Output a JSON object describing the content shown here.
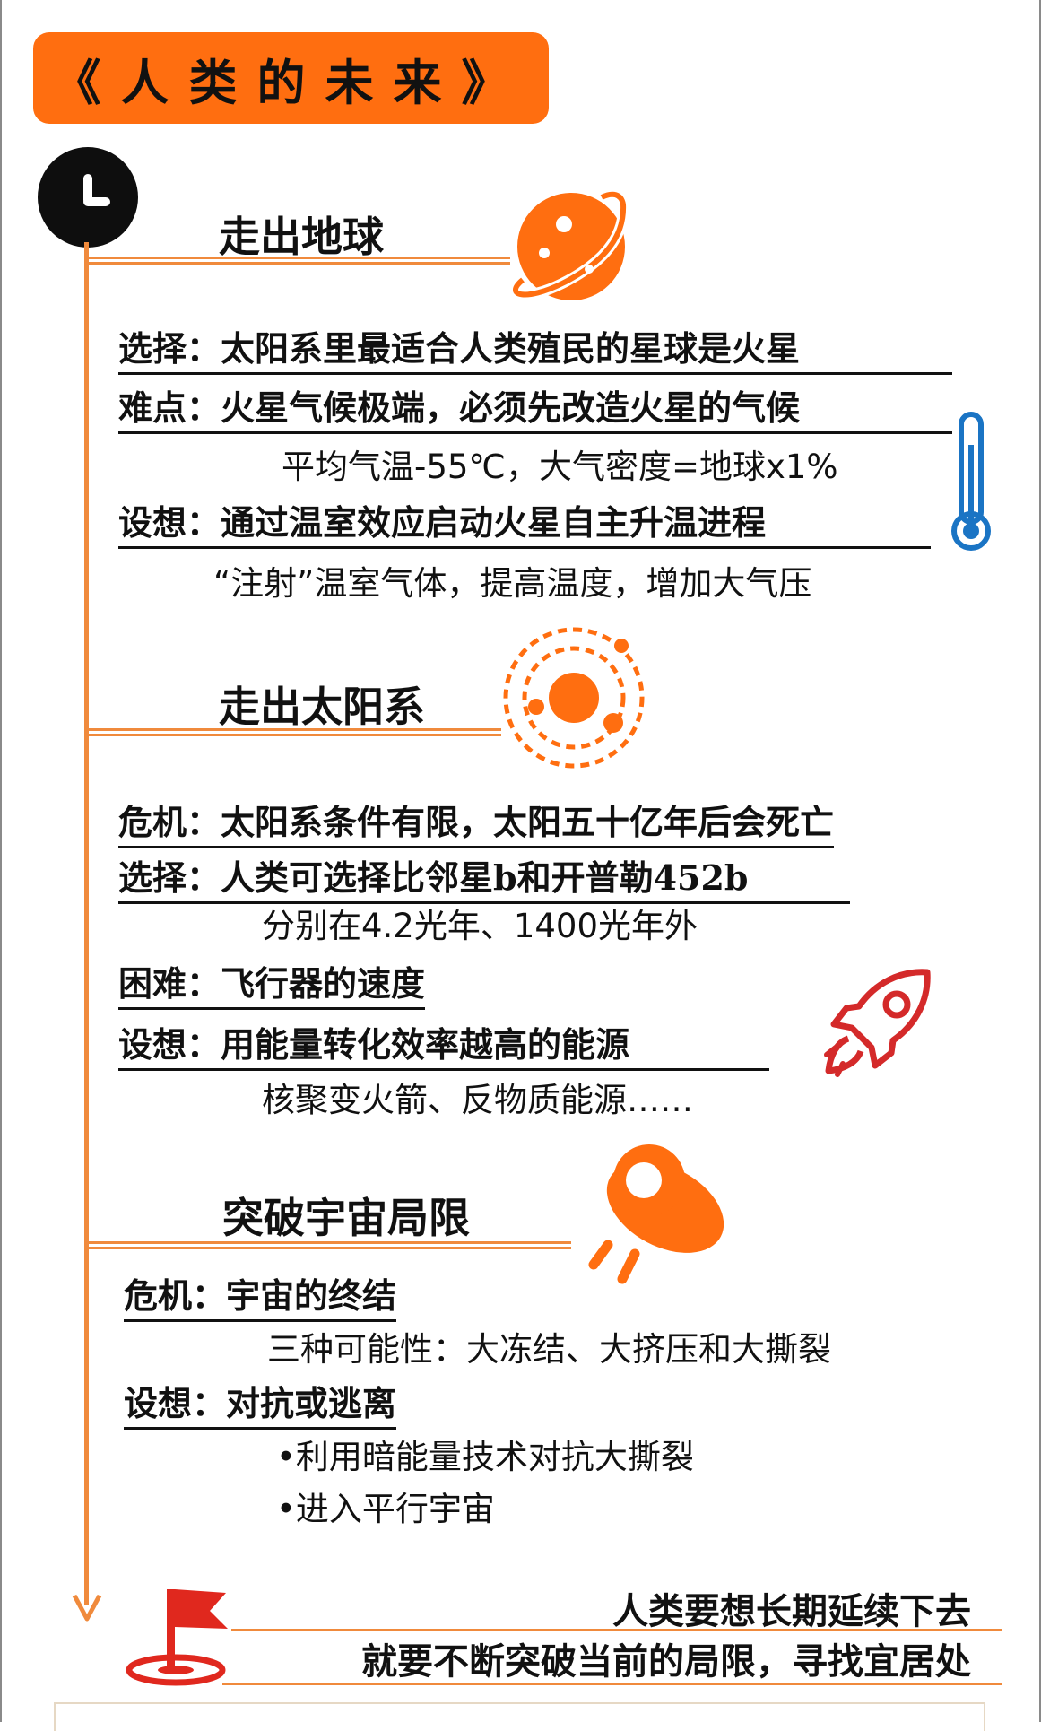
{
  "title": "《人类的未来》",
  "sections": [
    {
      "heading": "走出地球",
      "lines": [
        "选择：太阳系里最适合人类殖民的星球是火星",
        "难点：火星气候极端，必须先改造火星的气候",
        "平均气温-55℃，大气密度=地球x1%",
        "设想：通过温室效应启动火星自主升温进程",
        "“注射”温室气体，提高温度，增加大气压"
      ]
    },
    {
      "heading": "走出太阳系",
      "lines": [
        "危机：太阳系条件有限，太阳五十亿年后会死亡",
        "选择：人类可选择比邻星b和开普勒452b",
        "分别在4.2光年、1400光年外",
        "困难：飞行器的速度",
        "设想：用能量转化效率越高的能源",
        "核聚变火箭、反物质能源……"
      ]
    },
    {
      "heading": "突破宇宙局限",
      "lines": [
        "危机：宇宙的终结",
        "三种可能性：大冻结、大挤压和大撕裂",
        "设想：对抗或逃离",
        "•利用暗能量技术对抗大撕裂",
        "•进入平行宇宙"
      ]
    }
  ],
  "conclusion": [
    "人类要想长期延续下去",
    "就要不断突破当前的局限，寻找宜居处"
  ],
  "colors": {
    "accent": "#ff6e10",
    "timeline": "#f08a3c",
    "thermometer": "#1a74c4",
    "rocket": "#d42a2a",
    "flag": "#e0281e"
  },
  "icons": [
    "clock-icon",
    "planet-icon",
    "thermometer-icon",
    "solar-system-icon",
    "rocket-icon",
    "ufo-icon",
    "flag-icon"
  ]
}
